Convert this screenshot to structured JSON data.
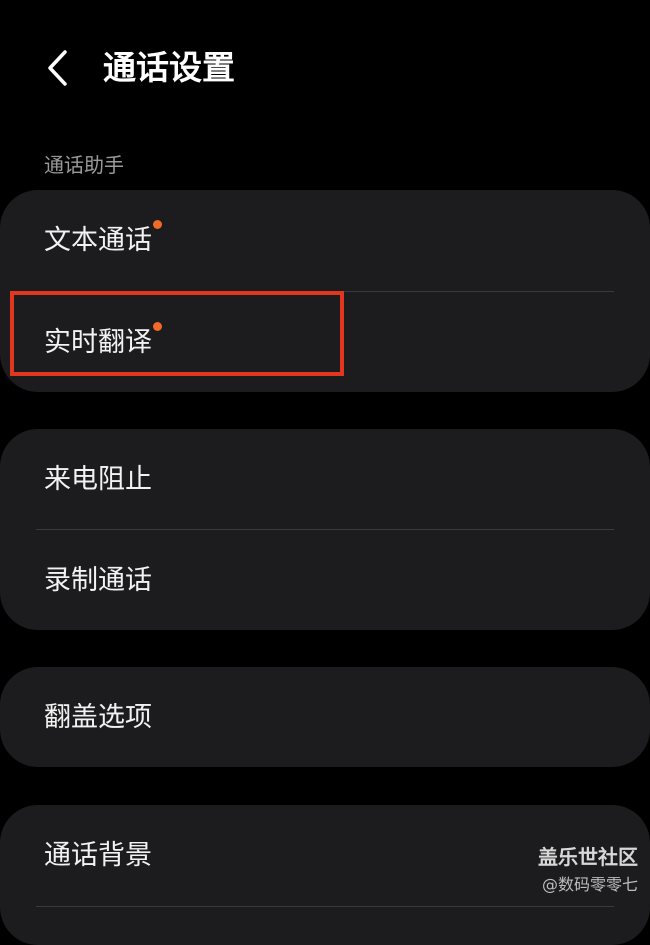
{
  "header": {
    "title": "通话设置",
    "back_icon": "chevron-left-icon"
  },
  "sections": {
    "assistant_label": "通话助手"
  },
  "groups": [
    {
      "items": [
        {
          "label": "文本通话",
          "badge": true
        },
        {
          "label": "实时翻译",
          "badge": true
        }
      ]
    },
    {
      "items": [
        {
          "label": "来电阻止"
        },
        {
          "label": "录制通话"
        }
      ]
    },
    {
      "items": [
        {
          "label": "翻盖选项"
        }
      ]
    },
    {
      "items": [
        {
          "label": "通话背景"
        }
      ]
    }
  ],
  "watermark": {
    "brand": "盖乐世社区",
    "user": "@数码零零七"
  },
  "colors": {
    "background": "#000000",
    "card": "#1c1c1e",
    "badge": "#f26a2a",
    "highlight": "#e2371f"
  }
}
